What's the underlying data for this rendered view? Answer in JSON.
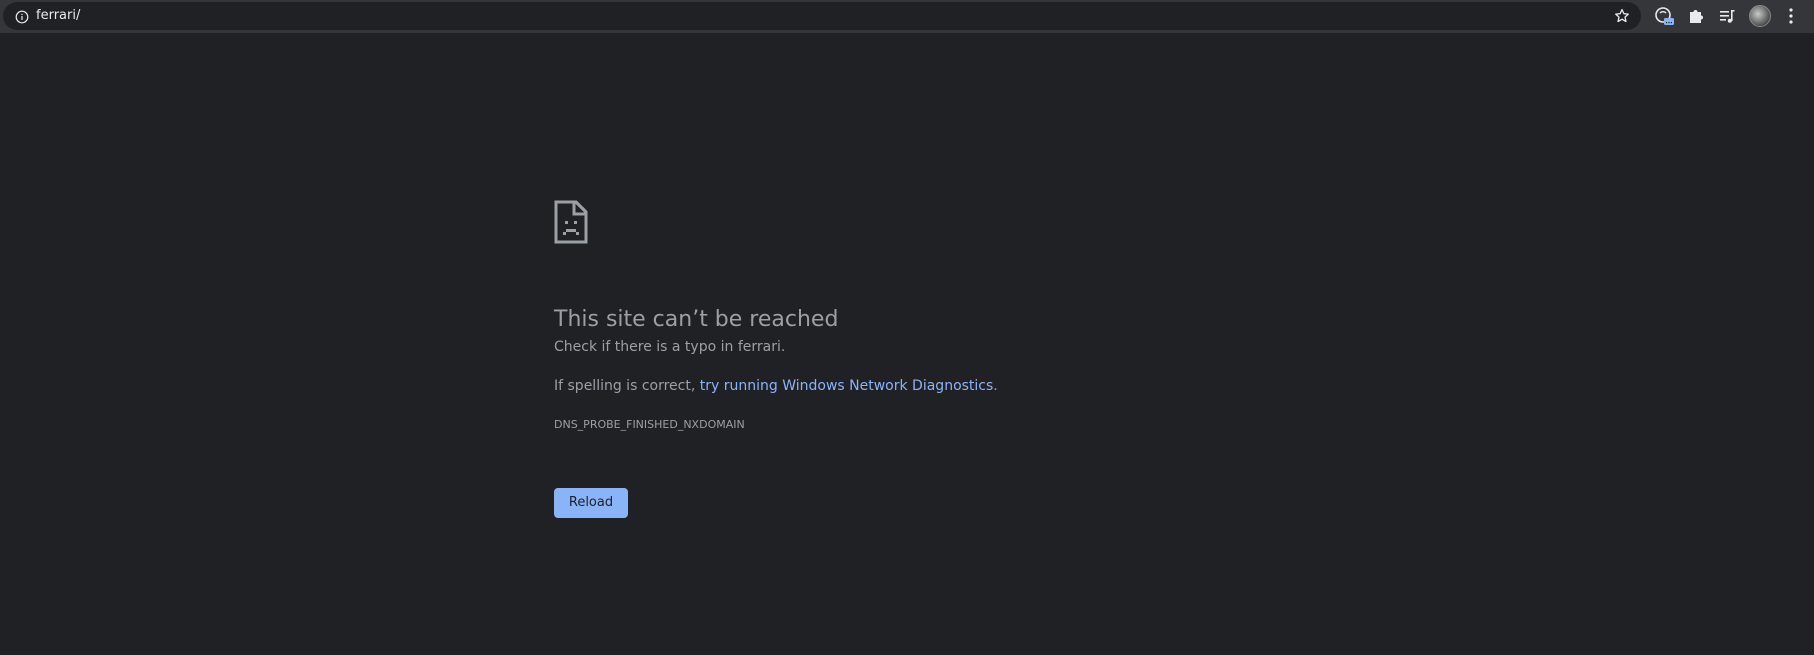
{
  "browser": {
    "url": "ferrari/",
    "icons": {
      "site_info": "info-icon",
      "bookmark": "star-icon",
      "extension_1": "lens-badge-icon",
      "extensions": "puzzle-icon",
      "reading_list": "reading-list-icon",
      "profile": "avatar",
      "menu": "kebab-menu-icon"
    }
  },
  "error_page": {
    "title": "This site can’t be reached",
    "typo_hint": "Check if there is a typo in ferrari.",
    "diagnostics_prefix": "If spelling is correct, ",
    "diagnostics_link": "try running Windows Network Diagnostics",
    "diagnostics_suffix": ".",
    "error_code": "DNS_PROBE_FINISHED_NXDOMAIN",
    "reload_label": "Reload"
  },
  "colors": {
    "page_background": "#202124",
    "toolbar": "#35363a",
    "text": "#9aa0a6",
    "link": "#8ab4f8",
    "button": "#8ab4f8"
  }
}
